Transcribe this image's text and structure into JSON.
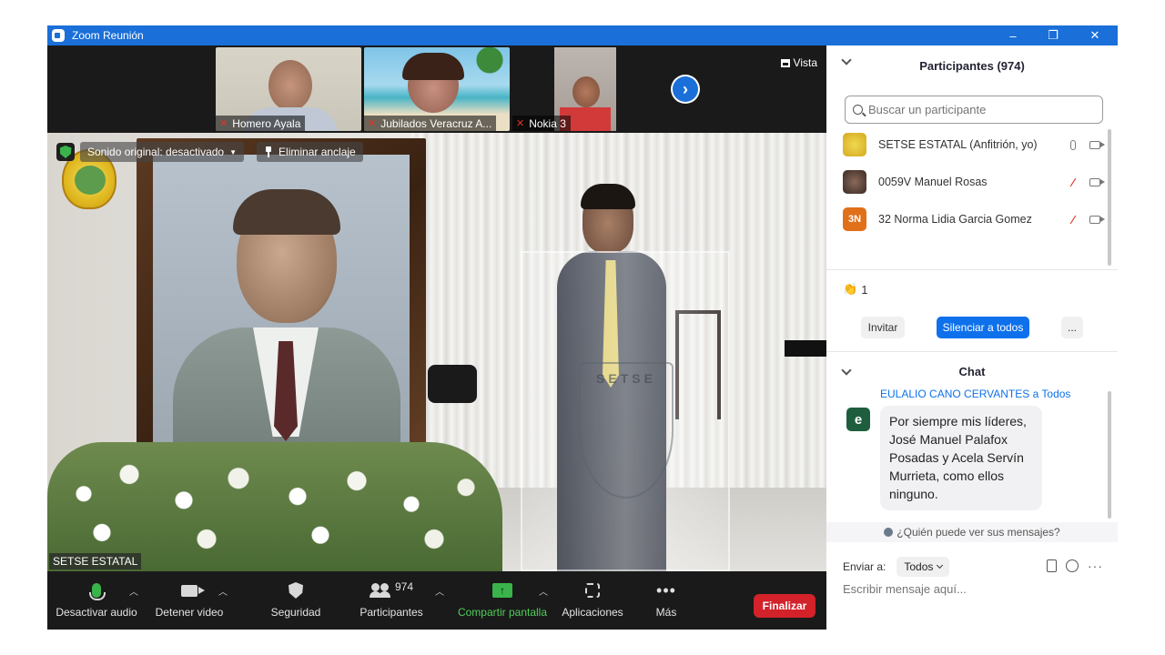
{
  "window": {
    "title": "Zoom Reunión",
    "minimize": "–",
    "restore": "❐",
    "close": "✕"
  },
  "video": {
    "thumbnails": [
      {
        "name": "Homero Ayala"
      },
      {
        "name": "Jubilados Veracruz A..."
      },
      {
        "name": "Nokia 3"
      }
    ],
    "view_label": "Vista",
    "original_sound": "Sonido original: desactivado",
    "unpin_label": "Eliminar anclaje",
    "main_speaker_name": "SETSE ESTATAL",
    "podium_text": "SETSE"
  },
  "toolbar": {
    "mute": "Desactivar audio",
    "stop_video": "Detener video",
    "security": "Seguridad",
    "participants": "Participantes",
    "participants_count": "974",
    "share": "Compartir pantalla",
    "apps": "Aplicaciones",
    "more": "Más",
    "end": "Finalizar"
  },
  "participants_panel": {
    "title": "Participantes (974)",
    "search_placeholder": "Buscar un participante",
    "items": [
      {
        "name": "SETSE ESTATAL (Anfitrión, yo)",
        "avatar_text": "",
        "mic": "on"
      },
      {
        "name": "0059V Manuel Rosas",
        "avatar_text": "",
        "mic": "off"
      },
      {
        "name": "32 Norma Lidia Garcia Gomez",
        "avatar_text": "3N",
        "mic": "off"
      }
    ],
    "reaction_count": "1",
    "invite": "Invitar",
    "mute_all": "Silenciar a todos",
    "more": "..."
  },
  "chat": {
    "title": "Chat",
    "sender": "EULALIO CANO CERVANTES a Todos",
    "sender_avatar": "e",
    "message": "Por siempre mis líderes, José Manuel Palafox Posadas y Acela Servín Murrieta, como ellos ninguno.",
    "who_can_see": "¿Quién puede ver sus mensajes?",
    "send_to_label": "Enviar a:",
    "send_to_value": "Todos",
    "input_placeholder": "Escribir mensaje aquí..."
  },
  "colors": {
    "accent": "#0e71eb",
    "titlebar": "#1a6fd8",
    "end": "#d3222a",
    "share": "#3ab44a"
  }
}
